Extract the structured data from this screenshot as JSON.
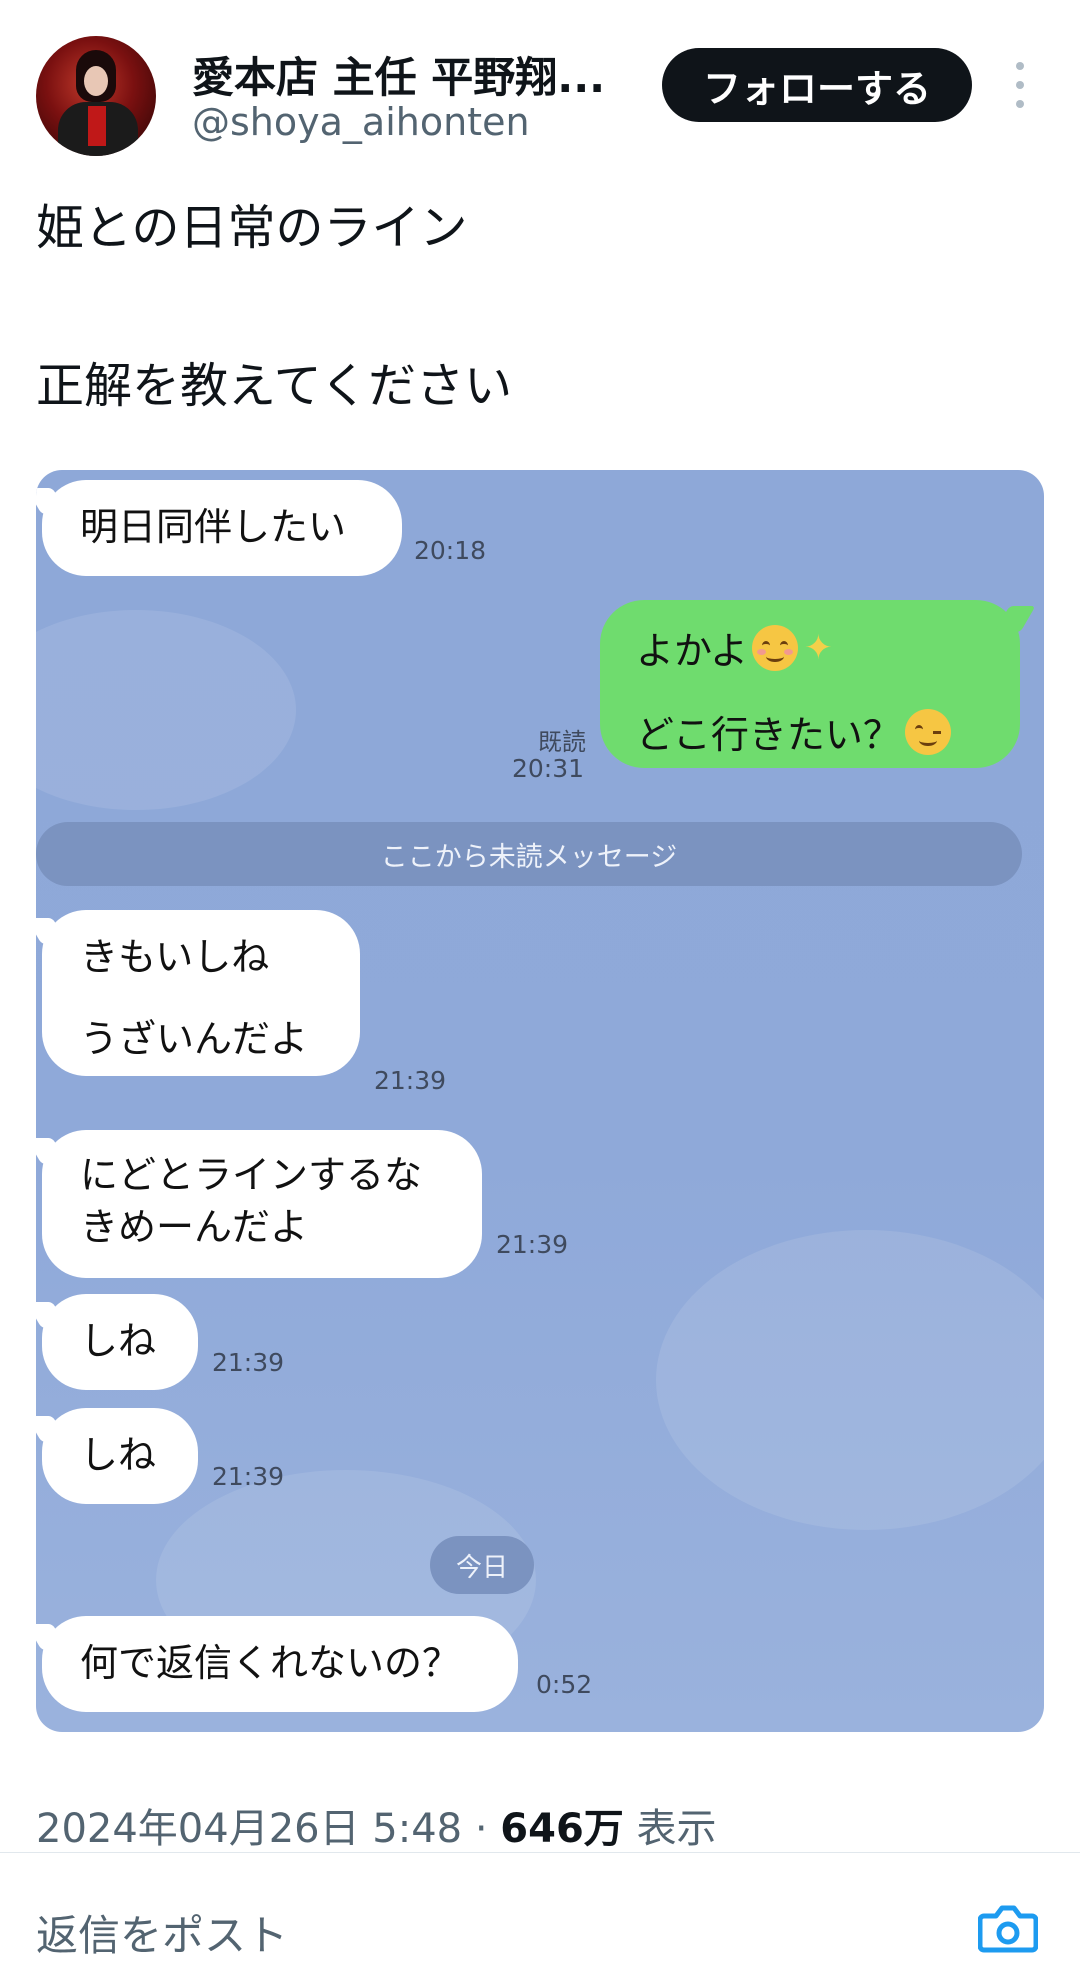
{
  "header": {
    "display_name": "愛本店 主任 平野翔...",
    "handle": "@shoya_aihonten",
    "follow_label": "フォローする"
  },
  "tweet": {
    "line1": "姫との日常のライン",
    "line2": "正解を教えてください"
  },
  "chat": {
    "messages": [
      {
        "side": "left",
        "text": "明日同伴したい",
        "time": "20:18"
      },
      {
        "side": "right",
        "line1": "よかよ",
        "line2": "どこ行きたい？",
        "read": "既読",
        "time": "20:31"
      },
      {
        "side": "left",
        "line1": "きもいしね",
        "line2": "うざいんだよ",
        "time": "21:39"
      },
      {
        "side": "left",
        "line1": "にどとラインするな",
        "line2": "きめーんだよ",
        "time": "21:39"
      },
      {
        "side": "left",
        "text": "しね",
        "time": "21:39"
      },
      {
        "side": "left",
        "text": "しね",
        "time": "21:39"
      },
      {
        "side": "left",
        "text": "何で返信くれないの？",
        "time": "0:52"
      }
    ],
    "unread_divider": "ここから未読メッセージ",
    "today_label": "今日"
  },
  "footer": {
    "date": "2024年04月26日 5:48 · ",
    "views_count": "646万",
    "views_label": " 表示",
    "reply_placeholder": "返信をポスト"
  },
  "colors": {
    "chat_bg": "#8fa9d9",
    "green_bubble": "#6fdc6e",
    "follow_button": "#0f1419",
    "camera_icon": "#1d9bf0"
  }
}
